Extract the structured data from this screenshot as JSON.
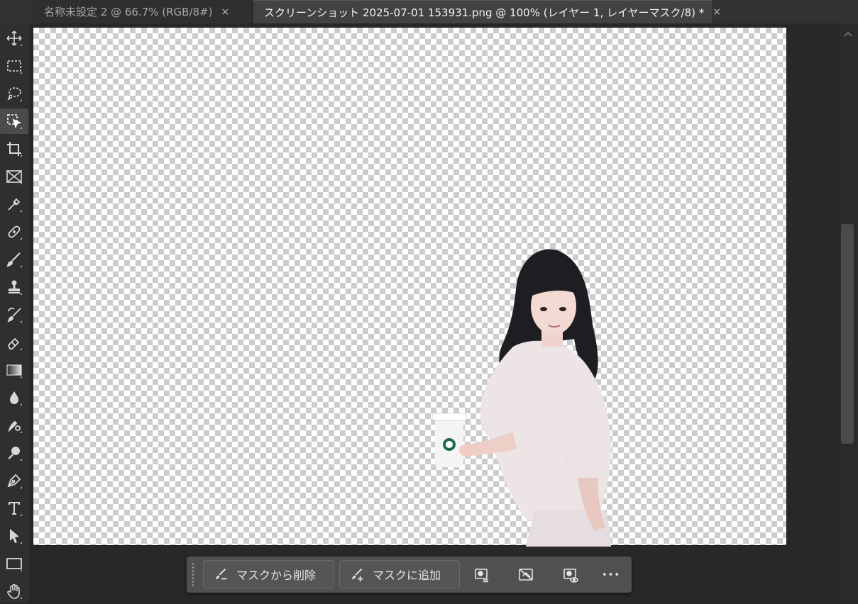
{
  "tabs": [
    {
      "title": "名称未設定 2 @ 66.7% (RGB/8#)",
      "close": "×",
      "active": false
    },
    {
      "title": "スクリーンショット 2025-07-01 153931.png @ 100% (レイヤー 1, レイヤーマスク/8) *",
      "close": "×",
      "active": true
    }
  ],
  "toolbar": {
    "tools": [
      {
        "icon": "move-tool-icon"
      },
      {
        "icon": "marquee-tool-icon"
      },
      {
        "icon": "lasso-tool-icon"
      },
      {
        "icon": "object-selection-tool-icon",
        "active": true
      },
      {
        "icon": "crop-tool-icon"
      },
      {
        "icon": "frame-tool-icon"
      },
      {
        "icon": "eyedropper-tool-icon"
      },
      {
        "icon": "healing-brush-tool-icon"
      },
      {
        "icon": "brush-tool-icon"
      },
      {
        "icon": "clone-stamp-tool-icon"
      },
      {
        "icon": "history-brush-tool-icon"
      },
      {
        "icon": "eraser-tool-icon"
      },
      {
        "icon": "gradient-tool-icon"
      },
      {
        "icon": "blur-tool-icon"
      },
      {
        "icon": "smudge-tool-icon"
      },
      {
        "icon": "dodge-tool-icon"
      },
      {
        "icon": "pen-tool-icon"
      },
      {
        "icon": "type-tool-icon"
      },
      {
        "icon": "path-selection-tool-icon"
      },
      {
        "icon": "rectangle-tool-icon"
      },
      {
        "icon": "hand-tool-icon"
      }
    ]
  },
  "taskbar": {
    "subtract_label": "マスクから削除",
    "add_label": "マスクに追加",
    "more_label": "•••"
  },
  "colors": {
    "background": "#282828",
    "panel": "#323232",
    "taskbar": "#505050",
    "checker_light": "#ffffff",
    "checker_dark": "#cccccc"
  }
}
